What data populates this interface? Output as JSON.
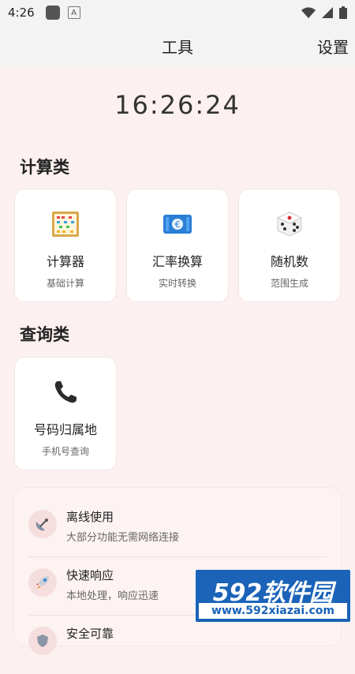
{
  "status_bar": {
    "time": "4:26",
    "a_badge": "A"
  },
  "appbar": {
    "title": "工具",
    "settings_label": "设置"
  },
  "clock": "16:26:24",
  "sections": [
    {
      "title": "计算类",
      "cards": [
        {
          "name": "计算器",
          "desc": "基础计算",
          "icon": "abacus-icon"
        },
        {
          "name": "汇率换算",
          "desc": "实时转换",
          "icon": "euro-banknote-icon"
        },
        {
          "name": "随机数",
          "desc": "范围生成",
          "icon": "dice-icon"
        }
      ]
    },
    {
      "title": "查询类",
      "cards": [
        {
          "name": "号码归属地",
          "desc": "手机号查询",
          "icon": "telephone-icon"
        }
      ]
    }
  ],
  "features": [
    {
      "title": "离线使用",
      "desc": "大部分功能无需网络连接",
      "icon": "satellite-dish-icon"
    },
    {
      "title": "快速响应",
      "desc": "本地处理，响应迅速",
      "icon": "rocket-icon"
    },
    {
      "title": "安全可靠",
      "desc": "",
      "icon": "shield-icon"
    }
  ],
  "watermark": {
    "top": "592软件园",
    "bottom": "www.592xiazai.com"
  },
  "colors": {
    "background": "#fdf0f0",
    "card": "#ffffff",
    "watermark": "#1a63b8"
  }
}
